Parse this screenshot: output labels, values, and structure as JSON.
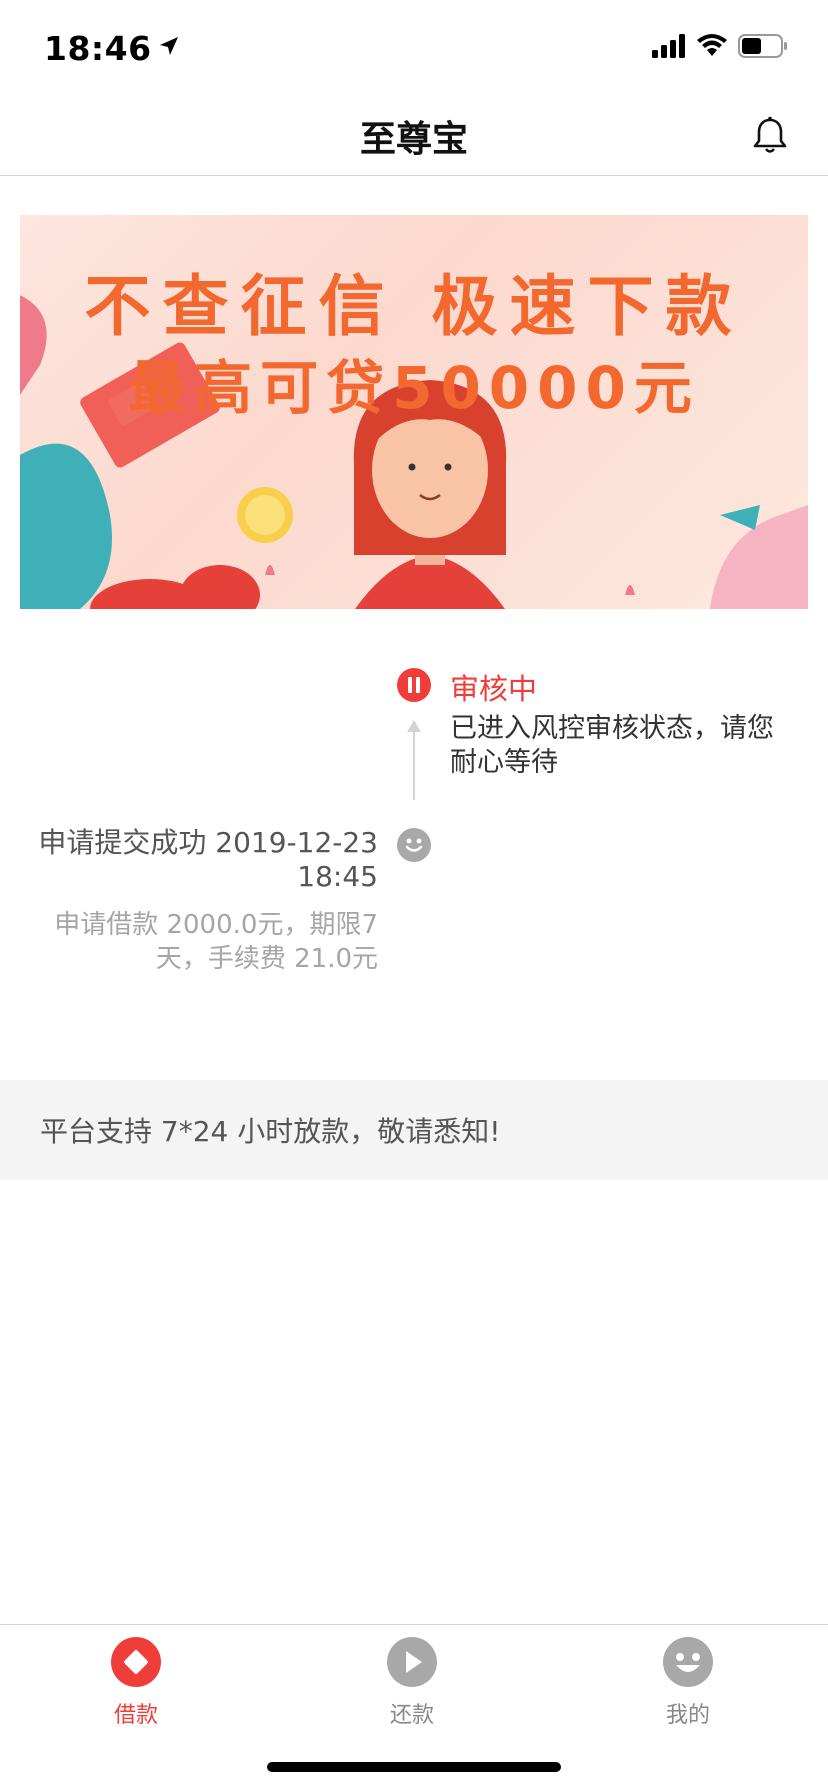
{
  "status_bar": {
    "time": "18:46",
    "icons": [
      "location-arrow-icon",
      "cellular-signal-icon",
      "wifi-icon",
      "battery-icon"
    ]
  },
  "nav": {
    "title": "至尊宝",
    "right_icon": "bell-icon"
  },
  "banner": {
    "line1": "不查征信 极速下款",
    "line2": "最高可贷50000元"
  },
  "timeline": {
    "current": {
      "status": "审核中",
      "description": "已进入风控审核状态，请您耐心等待",
      "icon": "pause-icon"
    },
    "submitted": {
      "title": "申请提交成功 2019-12-23 18:45",
      "description": "申请借款 2000.0元，期限7天，手续费 21.0元",
      "icon": "smile-icon"
    }
  },
  "notice": {
    "text": "平台支持 7*24 小时放款，敬请悉知!"
  },
  "tabbar": {
    "tabs": [
      {
        "label": "借款",
        "icon": "borrow-icon",
        "active": true
      },
      {
        "label": "还款",
        "icon": "repay-play-icon",
        "active": false
      },
      {
        "label": "我的",
        "icon": "profile-smile-icon",
        "active": false
      }
    ]
  },
  "colors": {
    "accent": "#ef3e3a",
    "banner_text": "#f3682f",
    "inactive": "#a8a8a8"
  }
}
